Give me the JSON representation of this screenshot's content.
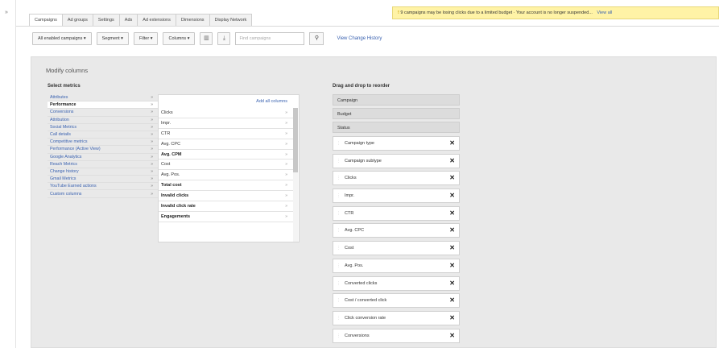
{
  "tabs": [
    "Campaigns",
    "Ad groups",
    "Settings",
    "Ads",
    "Ad extensions",
    "Dimensions",
    "Display Network"
  ],
  "notice": {
    "icon": "warning-icon",
    "text": "9 campaigns may be losing clicks due to a limited budget · Your account is no longer suspended...",
    "view_all": "View all"
  },
  "toolbar": {
    "campaigns_filter": "All enabled campaigns ▾",
    "segment": "Segment ▾",
    "filter": "Filter ▾",
    "columns": "Columns ▾",
    "search_placeholder": "Find campaigns",
    "change_history": "View Change History"
  },
  "modify_columns": {
    "title": "Modify columns",
    "select_metrics": "Select metrics",
    "categories": [
      {
        "label": "Attributes",
        "active": false
      },
      {
        "label": "Performance",
        "active": true
      },
      {
        "label": "Conversions",
        "active": false
      },
      {
        "label": "Attribution",
        "active": false
      },
      {
        "label": "Social Metrics",
        "active": false
      },
      {
        "label": "Call details",
        "active": false
      },
      {
        "label": "Competitive metrics",
        "active": false
      },
      {
        "label": "Performance (Active View)",
        "active": false
      },
      {
        "label": "Google Analytics",
        "active": false
      },
      {
        "label": "Reach Metrics",
        "active": false
      },
      {
        "label": "Change history",
        "active": false
      },
      {
        "label": "Gmail Metrics",
        "active": false
      },
      {
        "label": "YouTube Earned actions",
        "active": false
      },
      {
        "label": "Custom columns",
        "active": false
      }
    ],
    "add_all": "Add all columns",
    "metrics": [
      {
        "label": "Clicks",
        "bold": false
      },
      {
        "label": "Impr.",
        "bold": false
      },
      {
        "label": "CTR",
        "bold": false
      },
      {
        "label": "Avg. CPC",
        "bold": false
      },
      {
        "label": "Avg. CPM",
        "bold": true
      },
      {
        "label": "Cost",
        "bold": false
      },
      {
        "label": "Avg. Pos.",
        "bold": false
      },
      {
        "label": "Total cost",
        "bold": true
      },
      {
        "label": "Invalid clicks",
        "bold": true
      },
      {
        "label": "Invalid click rate",
        "bold": true
      },
      {
        "label": "Engagements",
        "bold": true
      }
    ],
    "reorder_title": "Drag and drop to reorder",
    "fixed_columns": [
      "Campaign",
      "Budget",
      "Status"
    ],
    "selected_columns": [
      "Campaign type",
      "Campaign subtype",
      "Clicks",
      "Impr.",
      "CTR",
      "Avg. CPC",
      "Cost",
      "Avg. Pos.",
      "Converted clicks",
      "Cost / converted click",
      "Click conversion rate",
      "Conversions"
    ]
  }
}
